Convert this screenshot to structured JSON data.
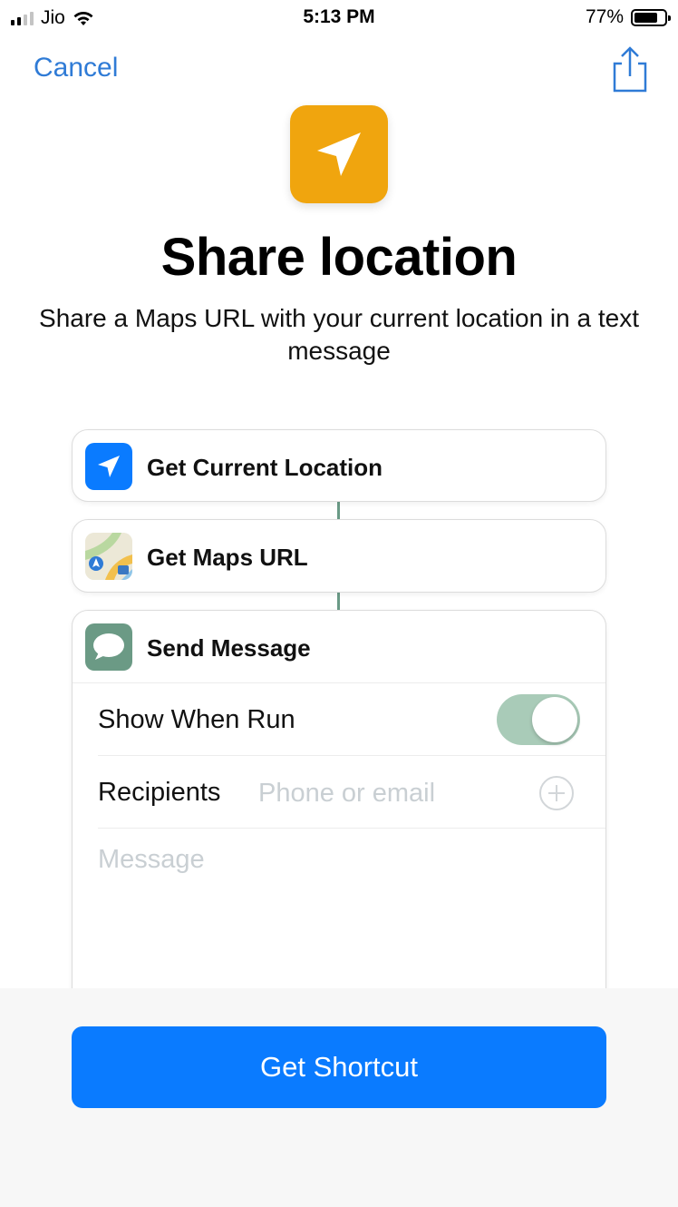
{
  "status_bar": {
    "carrier": "Jio",
    "time": "5:13 PM",
    "battery_percent": "77%",
    "battery_level": 0.77,
    "signal_bars_filled": 2,
    "signal_bars_total": 4
  },
  "nav": {
    "cancel_label": "Cancel",
    "share_icon": "share-icon"
  },
  "header": {
    "icon": "location-arrow-icon",
    "icon_color": "#f0a50e",
    "title": "Share location",
    "subtitle": "Share a Maps URL with your current location in a text message"
  },
  "actions": [
    {
      "label": "Get Current Location",
      "icon": "location-arrow-icon",
      "icon_color": "#0a7bff"
    },
    {
      "label": "Get Maps URL",
      "icon": "maps-icon"
    },
    {
      "label": "Send Message",
      "icon": "messages-icon",
      "icon_color": "#6b9a85"
    }
  ],
  "send_message": {
    "show_when_run_label": "Show When Run",
    "show_when_run_value": true,
    "recipients_label": "Recipients",
    "recipients_placeholder": "Phone or email",
    "message_placeholder": "Message"
  },
  "footer": {
    "get_shortcut_label": "Get Shortcut",
    "accent_color": "#0a7bff"
  }
}
